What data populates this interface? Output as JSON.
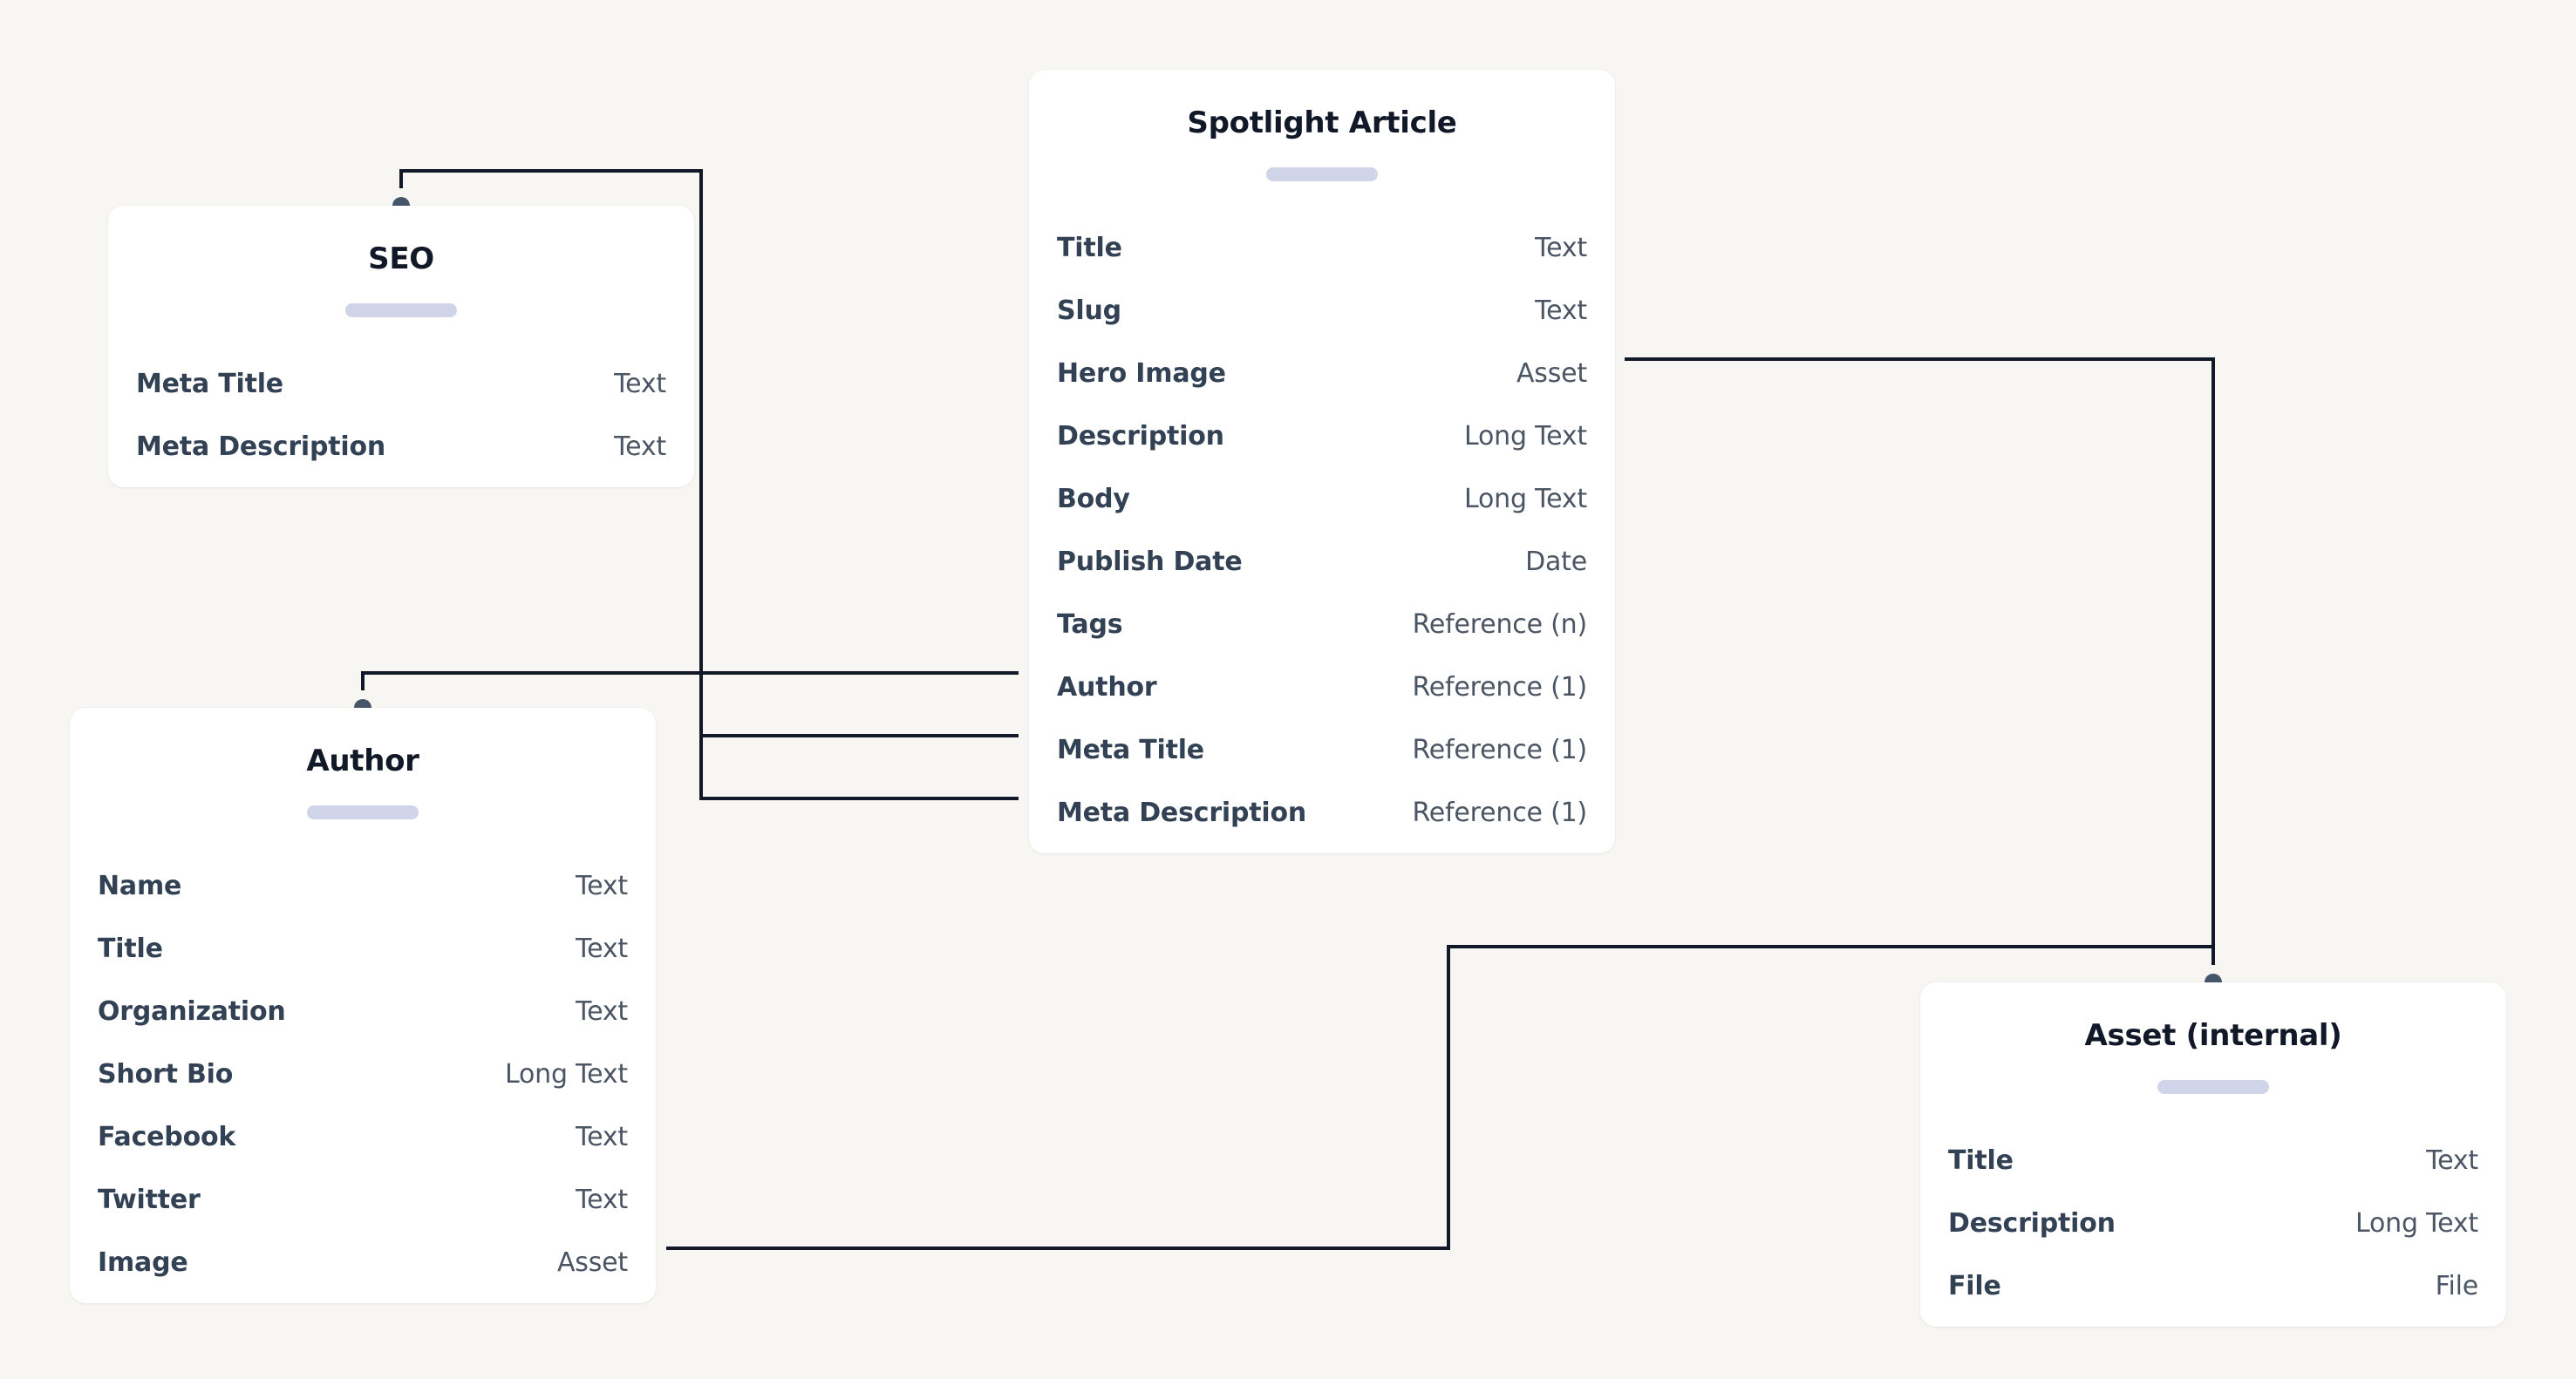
{
  "canvas": {
    "background": "#f7f6f3",
    "connector_color": "#111827",
    "anchor_color": "#475569",
    "pill_color": "#cfd4e8"
  },
  "models": {
    "seo": {
      "title": "SEO",
      "fields": [
        {
          "name": "Meta Title",
          "type": "Text"
        },
        {
          "name": "Meta Description",
          "type": "Text"
        }
      ]
    },
    "spotlight": {
      "title": "Spotlight Article",
      "fields": [
        {
          "name": "Title",
          "type": "Text"
        },
        {
          "name": "Slug",
          "type": "Text"
        },
        {
          "name": "Hero Image",
          "type": "Asset"
        },
        {
          "name": "Description",
          "type": "Long Text"
        },
        {
          "name": "Body",
          "type": "Long Text"
        },
        {
          "name": "Publish Date",
          "type": "Date"
        },
        {
          "name": "Tags",
          "type": "Reference (n)"
        },
        {
          "name": "Author",
          "type": "Reference (1)"
        },
        {
          "name": "Meta Title",
          "type": "Reference (1)"
        },
        {
          "name": "Meta Description",
          "type": "Reference (1)"
        }
      ]
    },
    "author": {
      "title": "Author",
      "fields": [
        {
          "name": "Name",
          "type": "Text"
        },
        {
          "name": "Title",
          "type": "Text"
        },
        {
          "name": "Organization",
          "type": "Text"
        },
        {
          "name": "Short Bio",
          "type": "Long Text"
        },
        {
          "name": "Facebook",
          "type": "Text"
        },
        {
          "name": "Twitter",
          "type": "Text"
        },
        {
          "name": "Image",
          "type": "Asset"
        }
      ]
    },
    "asset": {
      "title": "Asset (internal)",
      "fields": [
        {
          "name": "Title",
          "type": "Text"
        },
        {
          "name": "Description",
          "type": "Long Text"
        },
        {
          "name": "File",
          "type": "File"
        }
      ]
    }
  },
  "relations": [
    {
      "from_model": "Spotlight Article",
      "from_field": "Hero Image",
      "to_model": "Asset (internal)"
    },
    {
      "from_model": "Spotlight Article",
      "from_field": "Author",
      "to_model": "Author"
    },
    {
      "from_model": "Spotlight Article",
      "from_field": "Meta Title",
      "to_model": "SEO"
    },
    {
      "from_model": "Spotlight Article",
      "from_field": "Meta Description",
      "to_model": "SEO"
    },
    {
      "from_model": "Author",
      "from_field": "Image",
      "to_model": "Asset (internal)"
    }
  ]
}
